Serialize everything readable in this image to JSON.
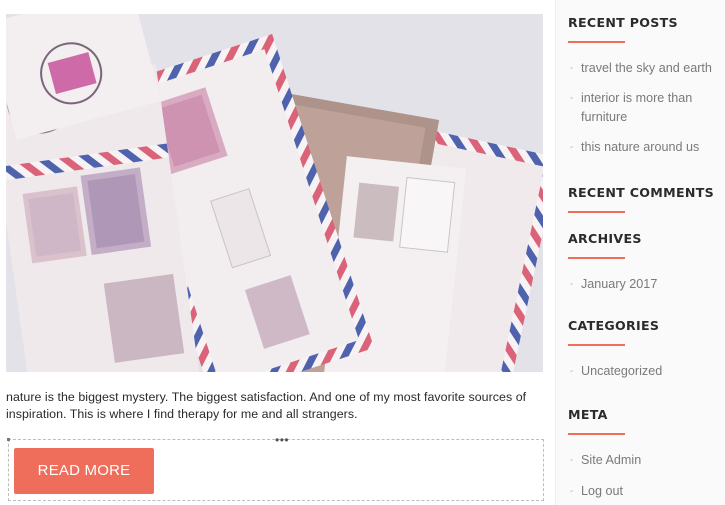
{
  "post": {
    "image_alt": "vintage air mail envelopes with stamps",
    "excerpt": "nature is the biggest mystery. The biggest satisfaction. And one of my most favorite sources of inspiration. This is where I find therapy for me and all strangers.",
    "read_more_label": "READ MORE",
    "editor_handle": "•••"
  },
  "sidebar": {
    "recent_posts": {
      "title": "RECENT POSTS",
      "items": [
        "travel the sky and earth",
        "interior is more than furniture",
        "this nature around us"
      ]
    },
    "recent_comments": {
      "title": "RECENT COMMENTS"
    },
    "archives": {
      "title": "ARCHIVES",
      "items": [
        "January 2017"
      ]
    },
    "categories": {
      "title": "CATEGORIES",
      "items": [
        "Uncategorized"
      ]
    },
    "meta": {
      "title": "META",
      "items": [
        "Site Admin",
        "Log out"
      ]
    }
  },
  "colors": {
    "accent": "#ee6d5b",
    "heading": "#2b2b2b",
    "link": "#7a7a7a"
  }
}
